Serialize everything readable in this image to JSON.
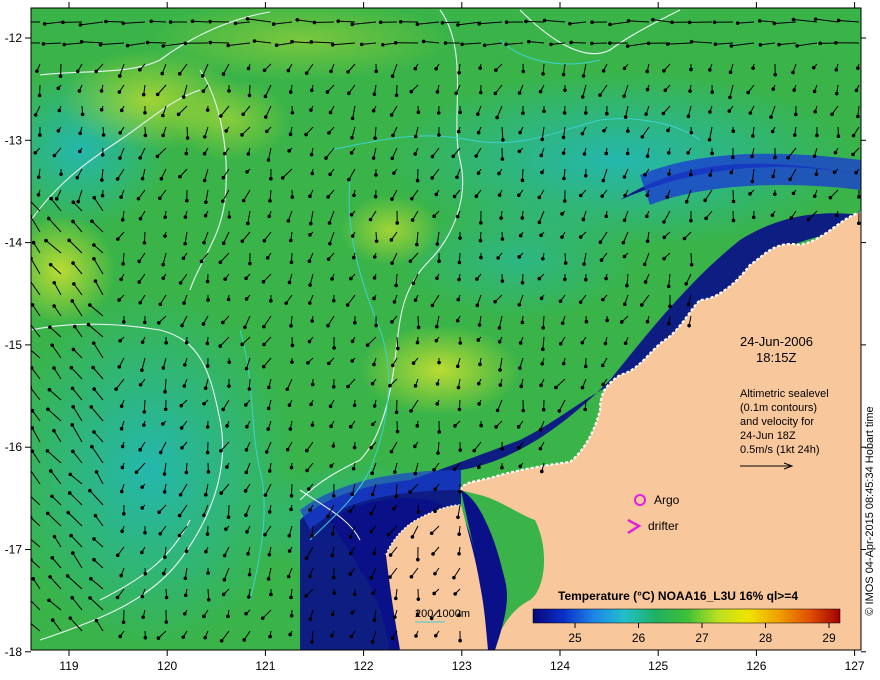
{
  "map": {
    "lon_ticks": [
      "119",
      "120",
      "121",
      "122",
      "123",
      "124",
      "125",
      "126",
      "127"
    ],
    "lat_ticks": [
      "-12",
      "-13",
      "-14",
      "-15",
      "-16",
      "-17",
      "-18"
    ]
  },
  "annotations": {
    "date": "24-Jun-2006",
    "time": "18:15Z",
    "info_lines": [
      "Altimetric sealevel",
      "(0.1m contours)",
      "and velocity for",
      "24-Jun 18Z",
      "0.5m/s (1kt 24h)"
    ],
    "argo_label": "Argo",
    "drifter_label": "drifter",
    "depth_label": "200  1000m"
  },
  "colorbar": {
    "title": "Temperature (°C) NOAA16_L3U 16% ql>=4",
    "ticks": [
      "25",
      "26",
      "27",
      "28",
      "29"
    ],
    "colors": [
      "#08087a",
      "#0a2fc8",
      "#1e86e8",
      "#22c0c8",
      "#20b060",
      "#3cc038",
      "#b8e020",
      "#f0e400",
      "#f0a000",
      "#e05000",
      "#a00000"
    ]
  },
  "credit": "© IMOS 04-Apr-2015 08:45:34 Hobart time",
  "colors": {
    "land": "#f8c89c",
    "deep_blue": "#0a1088",
    "ocean_green": "#38b848",
    "contour": "#e8f4f4",
    "isobath_200": "#40d0d0",
    "argo": "#e020e0"
  }
}
